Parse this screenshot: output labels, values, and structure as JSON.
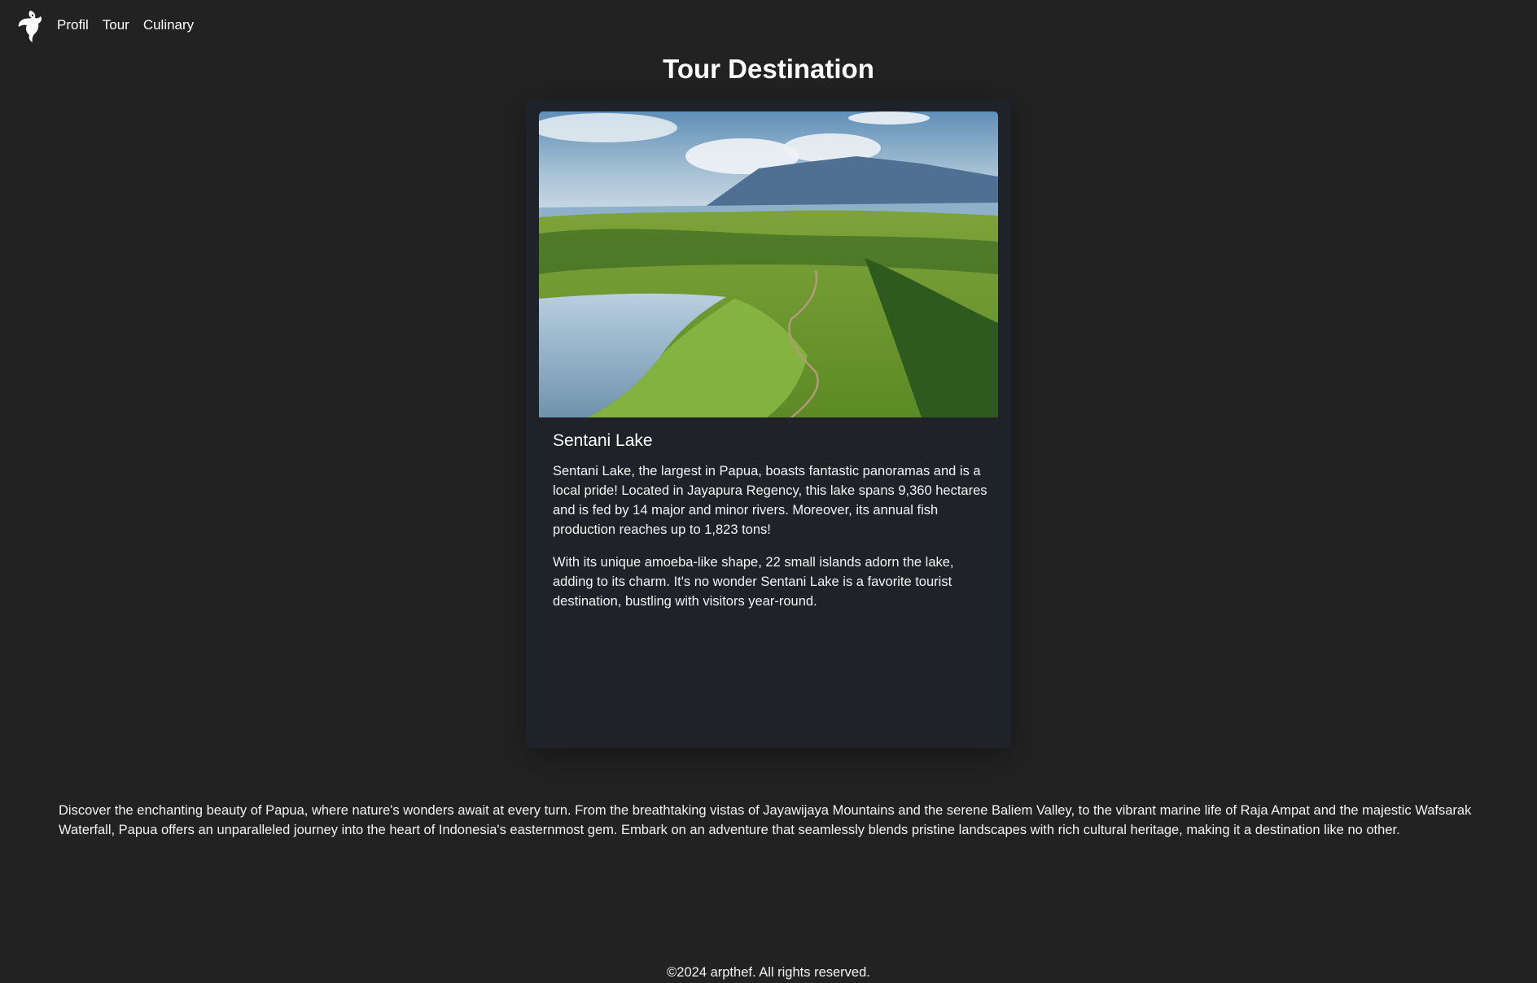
{
  "nav": {
    "logo_icon": "bird-of-paradise-logo-icon",
    "links": [
      {
        "label": "Profil"
      },
      {
        "label": "Tour"
      },
      {
        "label": "Culinary"
      }
    ]
  },
  "main": {
    "title": "Tour Destination"
  },
  "card": {
    "image_icon": "landscape-photo",
    "title": "Sentani Lake",
    "paragraphs": [
      "Sentani Lake, the largest in Papua, boasts fantastic panoramas and is a local pride! Located in Jayapura Regency, this lake spans 9,360 hectares and is fed by 14 major and minor rivers. Moreover, its annual fish production reaches up to 1,823 tons!",
      "With its unique amoeba-like shape, 22 small islands adorn the lake, adding to its charm. It's no wonder Sentani Lake is a favorite tourist destination, bustling with visitors year-round."
    ]
  },
  "about": {
    "text": "Discover the enchanting beauty of Papua, where nature's wonders await at every turn. From the breathtaking vistas of Jayawijaya Mountains and the serene Baliem Valley, to the vibrant marine life of Raja Ampat and the majestic Wafsarak Waterfall, Papua offers an unparalleled journey into the heart of Indonesia's easternmost gem. Embark on an adventure that seamlessly blends pristine landscapes with rich cultural heritage, making it a destination like no other."
  },
  "footer": {
    "copyright": "©2024 arpthef. All rights reserved."
  },
  "colors": {
    "page_bg": "#222222",
    "card_bg": "#1f2329",
    "text": "#ffffff"
  }
}
